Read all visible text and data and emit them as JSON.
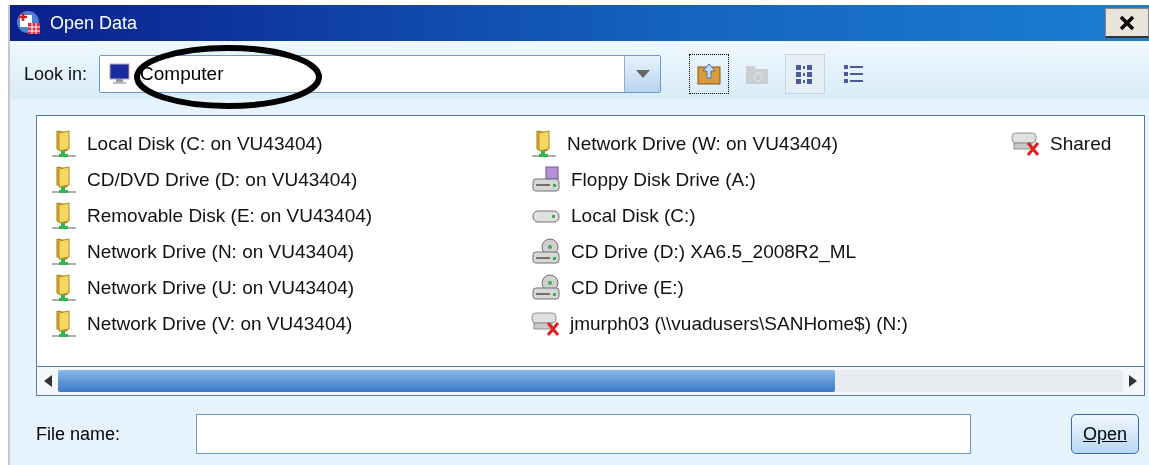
{
  "window": {
    "title": "Open Data"
  },
  "look_in": {
    "label": "Look in:",
    "value": "Computer"
  },
  "toolbar": [
    {
      "kind": "up-folder",
      "selected": false,
      "disabled": false
    },
    {
      "kind": "new-folder",
      "selected": false,
      "disabled": true
    },
    {
      "kind": "list-view",
      "selected": true,
      "disabled": false
    },
    {
      "kind": "details-view",
      "selected": false,
      "disabled": false
    }
  ],
  "items": [
    {
      "kind": "network",
      "name": "Local Disk (C: on VU43404)"
    },
    {
      "kind": "network",
      "name": "CD/DVD Drive (D: on VU43404)"
    },
    {
      "kind": "network",
      "name": "Removable Disk (E: on VU43404)"
    },
    {
      "kind": "network",
      "name": "Network Drive (N: on VU43404)"
    },
    {
      "kind": "network",
      "name": "Network Drive (U: on VU43404)"
    },
    {
      "kind": "network",
      "name": "Network Drive (V: on VU43404)"
    },
    {
      "kind": "network",
      "name": "Network Drive (W: on VU43404)"
    },
    {
      "kind": "floppy",
      "name": "Floppy Disk Drive (A:)"
    },
    {
      "kind": "disk",
      "name": "Local Disk (C:)"
    },
    {
      "kind": "cd",
      "name": "CD Drive (D:) XA6.5_2008R2_ML"
    },
    {
      "kind": "cd",
      "name": "CD Drive (E:)"
    },
    {
      "kind": "disconnected",
      "name": "jmurph03 (\\\\vuadusers\\SANHome$) (N:)"
    },
    {
      "kind": "disconnected",
      "name": "Shared"
    }
  ],
  "file_name": {
    "label": "File name:"
  },
  "open_button": "Open"
}
